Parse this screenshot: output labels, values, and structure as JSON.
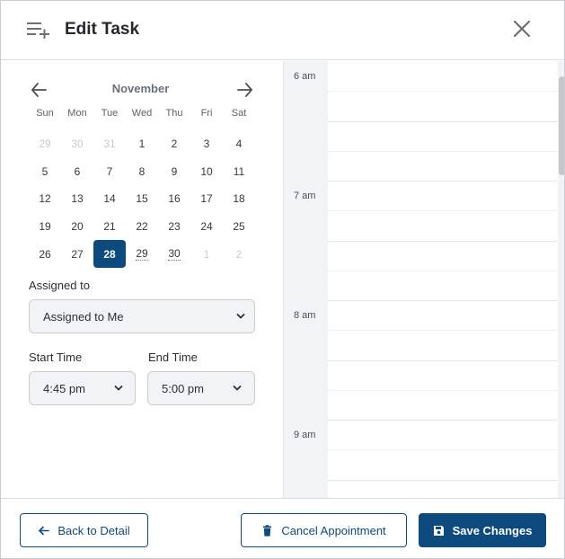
{
  "header": {
    "title": "Edit Task",
    "icon": "task-add-icon",
    "close_icon": "close-icon"
  },
  "calendar": {
    "month": "November",
    "weekdays": [
      "Sun",
      "Mon",
      "Tue",
      "Wed",
      "Thu",
      "Fri",
      "Sat"
    ],
    "weeks": [
      [
        {
          "d": "29",
          "m": true
        },
        {
          "d": "30",
          "m": true
        },
        {
          "d": "31",
          "m": true
        },
        {
          "d": "1"
        },
        {
          "d": "2"
        },
        {
          "d": "3"
        },
        {
          "d": "4"
        }
      ],
      [
        {
          "d": "5"
        },
        {
          "d": "6"
        },
        {
          "d": "7"
        },
        {
          "d": "8"
        },
        {
          "d": "9"
        },
        {
          "d": "10"
        },
        {
          "d": "11"
        }
      ],
      [
        {
          "d": "12"
        },
        {
          "d": "13"
        },
        {
          "d": "14"
        },
        {
          "d": "15"
        },
        {
          "d": "16"
        },
        {
          "d": "17"
        },
        {
          "d": "18"
        }
      ],
      [
        {
          "d": "19"
        },
        {
          "d": "20"
        },
        {
          "d": "21"
        },
        {
          "d": "22"
        },
        {
          "d": "23"
        },
        {
          "d": "24"
        },
        {
          "d": "25"
        }
      ],
      [
        {
          "d": "26"
        },
        {
          "d": "27"
        },
        {
          "d": "28",
          "sel": true
        },
        {
          "d": "29",
          "dot": true
        },
        {
          "d": "30",
          "dot": true
        },
        {
          "d": "1",
          "m": true
        },
        {
          "d": "2",
          "m": true
        }
      ]
    ],
    "selected_day": "28"
  },
  "form": {
    "assigned_label": "Assigned to",
    "assigned_value": "Assigned to Me",
    "start_label": "Start Time",
    "start_value": "4:45 pm",
    "end_label": "End Time",
    "end_value": "5:00 pm"
  },
  "schedule": {
    "hours": [
      "6 am",
      "7 am",
      "8 am",
      "9 am"
    ]
  },
  "footer": {
    "back_label": "Back to Detail",
    "cancel_label": "Cancel Appointment",
    "save_label": "Save Changes"
  },
  "colors": {
    "primary": "#0d4a7d",
    "muted_text": "#c9ccd1",
    "panel_bg": "#f2f3f6"
  }
}
